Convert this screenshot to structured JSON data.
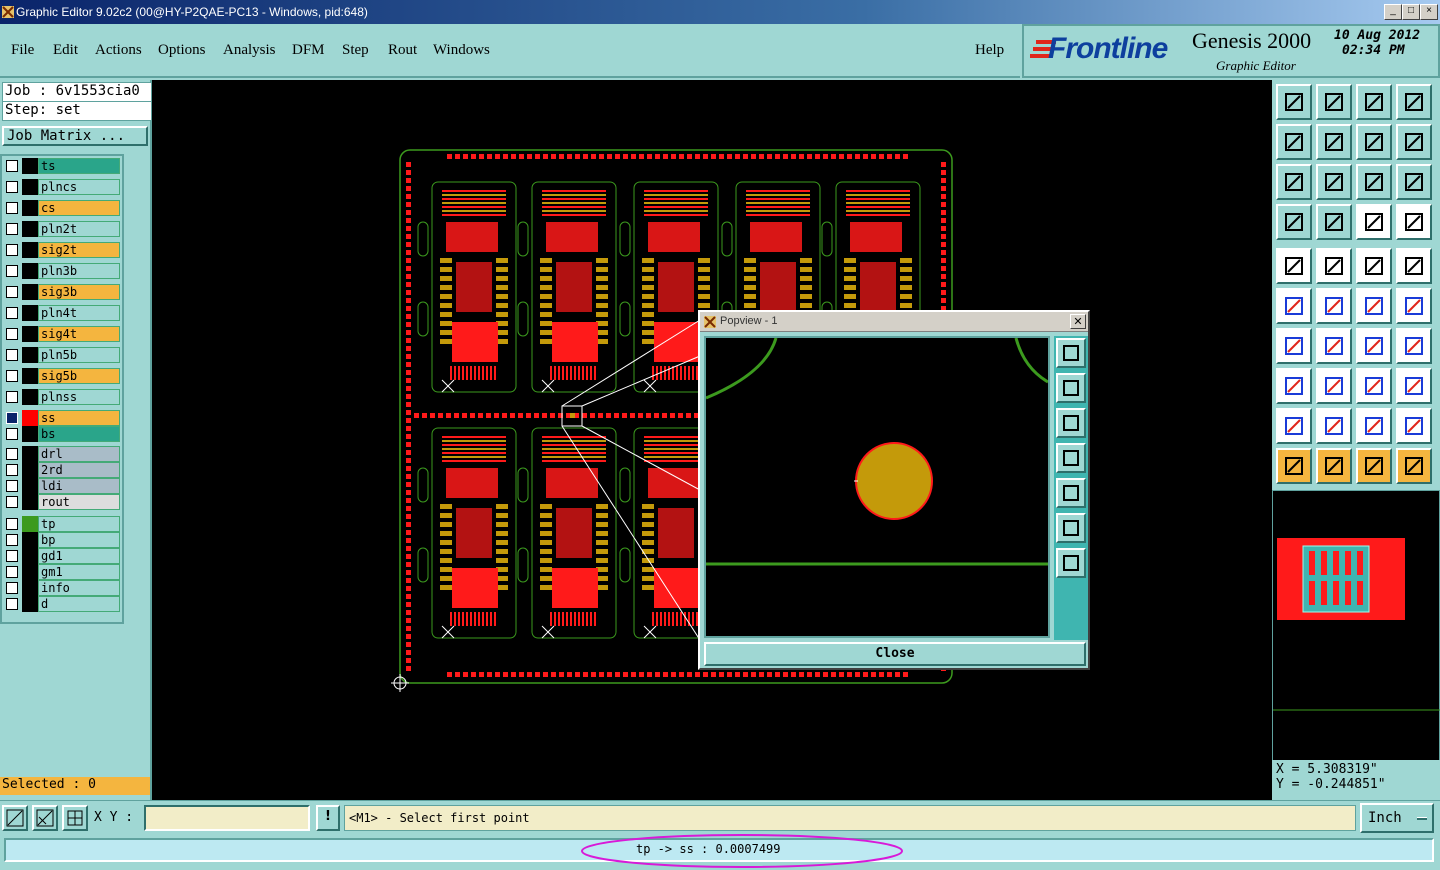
{
  "window": {
    "title": "Graphic Editor 9.02c2 (00@HY-P2QAE-PC13 - Windows, pid:648)",
    "controls": [
      "_",
      "□",
      "×"
    ]
  },
  "menu": {
    "items": [
      {
        "label": "File"
      },
      {
        "label": "Edit"
      },
      {
        "label": "Actions"
      },
      {
        "label": "Options"
      },
      {
        "label": "Analysis"
      },
      {
        "label": "DFM"
      },
      {
        "label": "Step"
      },
      {
        "label": "Rout"
      },
      {
        "label": "Windows"
      }
    ],
    "help": "Help"
  },
  "brand": {
    "logo": "Frontline",
    "product": "Genesis 2000",
    "subtitle": "Graphic Editor",
    "date": "10 Aug 2012",
    "time": "02:34 PM"
  },
  "job": {
    "job_line": "Job : 6v1553cia0",
    "step_line": "Step: set",
    "matrix_button": "Job Matrix ..."
  },
  "layers": [
    {
      "name": "ts",
      "color": "#2aa58a",
      "swatch": "#000000"
    },
    {
      "name": "plncs",
      "color": "#9fd7d3",
      "swatch": "#000000"
    },
    {
      "name": "cs",
      "color": "#f4b53f",
      "swatch": "#000000"
    },
    {
      "name": "pln2t",
      "color": "#9fd7d3",
      "swatch": "#000000"
    },
    {
      "name": "sig2t",
      "color": "#f4b53f",
      "swatch": "#000000"
    },
    {
      "name": "pln3b",
      "color": "#9fd7d3",
      "swatch": "#000000"
    },
    {
      "name": "sig3b",
      "color": "#f4b53f",
      "swatch": "#000000"
    },
    {
      "name": "pln4t",
      "color": "#9fd7d3",
      "swatch": "#000000"
    },
    {
      "name": "sig4t",
      "color": "#f4b53f",
      "swatch": "#000000"
    },
    {
      "name": "pln5b",
      "color": "#9fd7d3",
      "swatch": "#000000"
    },
    {
      "name": "sig5b",
      "color": "#f4b53f",
      "swatch": "#000000"
    },
    {
      "name": "plnss",
      "color": "#9fd7d3",
      "swatch": "#000000"
    },
    {
      "name": "ss",
      "color": "#f4b53f",
      "swatch": "#ff0000",
      "active": true
    },
    {
      "name": "bs",
      "color": "#2aa58a",
      "swatch": "#000000"
    },
    {
      "name": "drl",
      "color": "#a9bcc8",
      "swatch": "#000000"
    },
    {
      "name": "2rd",
      "color": "#a9bcc8",
      "swatch": "#000000"
    },
    {
      "name": "ldi",
      "color": "#a9bcc8",
      "swatch": "#000000"
    },
    {
      "name": "rout",
      "color": "#dddddd",
      "swatch": "#000000"
    },
    {
      "name": "tp",
      "color": "#9fd7d3",
      "swatch": "#3c9a1e"
    },
    {
      "name": "bp",
      "color": "#9fd7d3",
      "swatch": "#000000"
    },
    {
      "name": "gd1",
      "color": "#9fd7d3",
      "swatch": "#000000"
    },
    {
      "name": "gm1",
      "color": "#9fd7d3",
      "swatch": "#000000"
    },
    {
      "name": "info",
      "color": "#9fd7d3",
      "swatch": "#000000"
    },
    {
      "name": "d",
      "color": "#9fd7d3",
      "swatch": "#000000"
    }
  ],
  "selected": "Selected : 0",
  "popview": {
    "title": "Popview - 1",
    "close_label": "Close"
  },
  "coords": {
    "x": "X = 5.308319\"",
    "y": "Y = -0.244851\""
  },
  "cmd": {
    "xy_label": "X Y :",
    "xy_value": "",
    "prompt": "<M1> - Select first point",
    "units": "Inch"
  },
  "status": {
    "measure": "tp -> ss : 0.0007499"
  },
  "colors": {
    "panel": "#9fd7d3",
    "copper": "#ff1a1a",
    "outline": "#3c9a1e",
    "pad": "#c49a0a",
    "highlight": "#d81ad8"
  }
}
